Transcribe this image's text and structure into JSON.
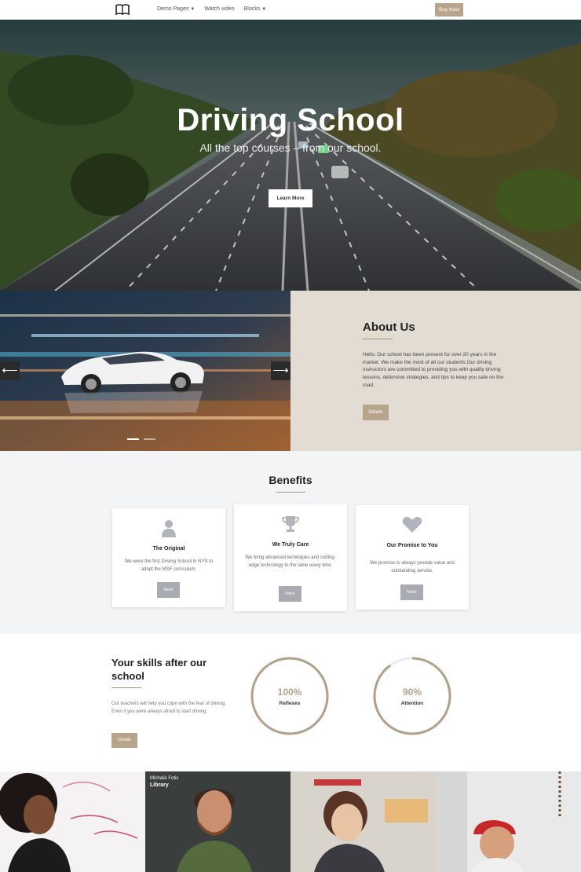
{
  "nav": {
    "links": [
      "Demo Pages",
      "Watch video",
      "Blocks"
    ],
    "buy_label": "Buy Now"
  },
  "hero": {
    "title": "Driving School",
    "subtitle": "All the top courses – from our school.",
    "button_label": "Learn More"
  },
  "slider": {
    "prev_glyph": "⟵",
    "next_glyph": "⟶",
    "slides": 2,
    "active_slide": 1
  },
  "about": {
    "title": "About Us",
    "text": "Hello. Our school has been present for over 20 years in the market. We make the most of all our students.Our driving instructors are committed to providing you with quality driving lessons, defensive strategies, and tips to keep you safe on the road.",
    "button_label": "Details"
  },
  "benefits": {
    "title": "Benefits",
    "cards": [
      {
        "icon": "user-icon",
        "title": "The Original",
        "text": "We were the first Driving School in NYS to adopt the MSF curriculum.",
        "button": "More"
      },
      {
        "icon": "trophy-icon",
        "title": "We Truly Care",
        "text": "We bring advanced techniques and cutting-edge technology to the table every time.",
        "button": "More"
      },
      {
        "icon": "heart-icon",
        "title": "Our Promise to You",
        "text": "We promise to always provide value and outstanding service.",
        "button": "More"
      }
    ]
  },
  "skills": {
    "title": "Your skills after our school",
    "text": "Our teachers will help you cope with the fear of driving. Even if you were always afraid to start driving",
    "button_label": "Details",
    "gauges": [
      {
        "value": "100%",
        "label": "Reflexes",
        "fraction": 1.0
      },
      {
        "value": "90%",
        "label": "Attention",
        "fraction": 0.9
      }
    ]
  },
  "team": {
    "featured_name": "Michalis Fotis",
    "featured_role": "Library"
  },
  "colors": {
    "accent": "#b8a48b",
    "about_bg": "#e2dcd3",
    "benefits_bg": "#f3f4f6",
    "card_button": "#a8abb1"
  }
}
